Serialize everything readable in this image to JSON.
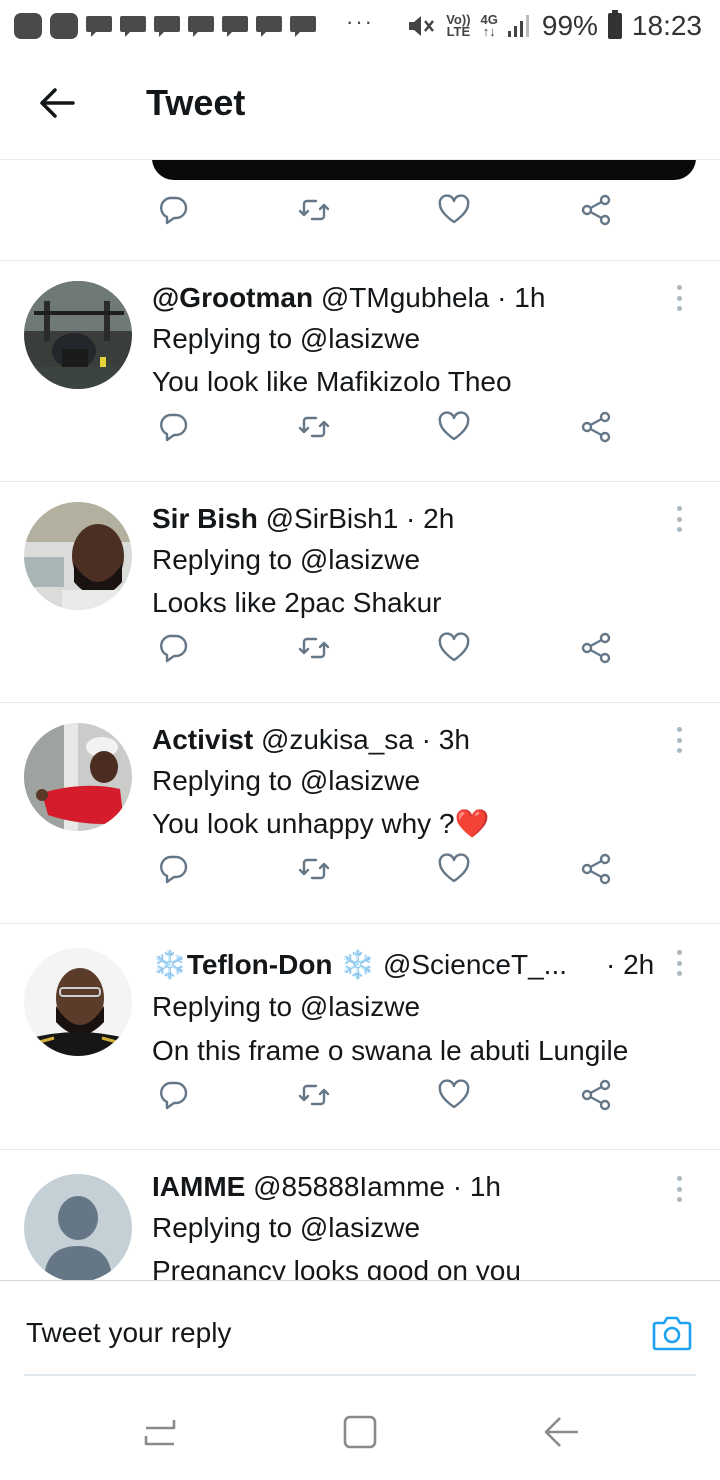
{
  "status_bar": {
    "network_top": "Vo))",
    "network_bottom": "LTE",
    "signal_top": "4G",
    "signal_bottom": "↑↓",
    "battery": "99%",
    "time": "18:23",
    "overflow": "···"
  },
  "header": {
    "title": "Tweet"
  },
  "tweets": [
    {
      "name": "@Grootman",
      "handle": "@TMgubhela · 1h",
      "replying_to": "Replying to @lasizwe",
      "text": "You look like Mafikizolo Theo"
    },
    {
      "name": "Sir Bish",
      "handle": "@SirBish1 · 2h",
      "replying_to": "Replying to @lasizwe",
      "text": "Looks like 2pac Shakur"
    },
    {
      "name": "Activist",
      "handle": "@zukisa_sa · 3h",
      "replying_to": "Replying to @lasizwe",
      "text": "You look unhappy why ?❤️"
    },
    {
      "name": "❄️Teflon-Don ❄️",
      "handle": "@ScienceT_...",
      "time": "· 2h",
      "replying_to": "Replying to @lasizwe",
      "text": "On this frame o swana le abuti Lungile"
    },
    {
      "name": "IAMME",
      "handle": "@85888Iamme · 1h",
      "replying_to": "Replying to @lasizwe",
      "text": "Pregnancy looks good on you"
    }
  ],
  "reply_bar": {
    "placeholder": "Tweet your reply"
  },
  "colors": {
    "icon_gray": "#657786",
    "divider": "#e1e8ed",
    "accent_blue": "#1da1f2",
    "heart_red": "#e0245e"
  }
}
